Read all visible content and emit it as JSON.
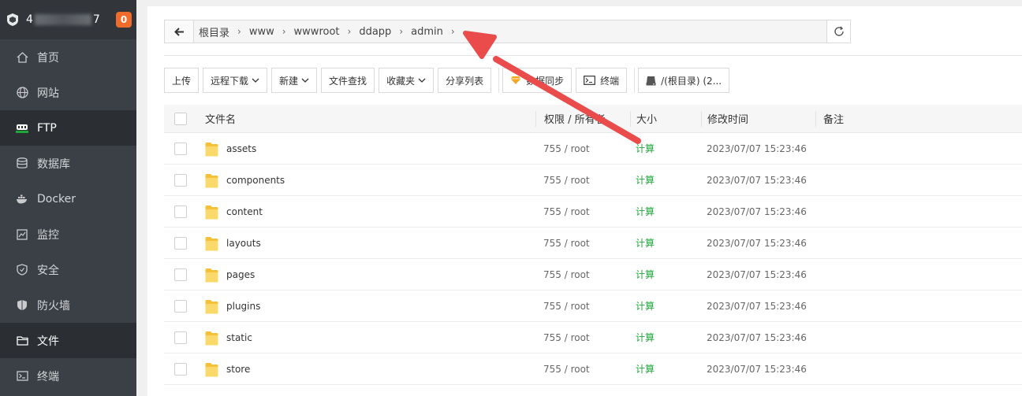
{
  "sidebar": {
    "server_prefix": "4",
    "server_suffix": "7",
    "badge": "0",
    "items": [
      {
        "label": "首页",
        "icon": "home-icon"
      },
      {
        "label": "网站",
        "icon": "globe-icon"
      },
      {
        "label": "FTP",
        "icon": "ftp-icon"
      },
      {
        "label": "数据库",
        "icon": "database-icon"
      },
      {
        "label": "Docker",
        "icon": "docker-icon"
      },
      {
        "label": "监控",
        "icon": "monitor-icon"
      },
      {
        "label": "安全",
        "icon": "shield-icon"
      },
      {
        "label": "防火墙",
        "icon": "firewall-icon"
      },
      {
        "label": "文件",
        "icon": "folder-icon"
      },
      {
        "label": "终端",
        "icon": "terminal-icon"
      }
    ]
  },
  "path": {
    "crumbs": [
      "根目录",
      "www",
      "wwwroot",
      "ddapp",
      "admin"
    ]
  },
  "toolbar": {
    "upload": "上传",
    "remote_download": "远程下载",
    "new": "新建",
    "file_search": "文件查找",
    "favorites": "收藏夹",
    "share_list": "分享列表",
    "sync": "数据同步",
    "terminal": "终端",
    "disk": "/(根目录) (2..."
  },
  "table": {
    "headers": {
      "name": "文件名",
      "perm": "权限 / 所有者",
      "size": "大小",
      "mtime": "修改时间",
      "note": "备注"
    },
    "rows": [
      {
        "name": "assets",
        "perm": "755 / root",
        "size": "计算",
        "mtime": "2023/07/07 15:23:46"
      },
      {
        "name": "components",
        "perm": "755 / root",
        "size": "计算",
        "mtime": "2023/07/07 15:23:46"
      },
      {
        "name": "content",
        "perm": "755 / root",
        "size": "计算",
        "mtime": "2023/07/07 15:23:46"
      },
      {
        "name": "layouts",
        "perm": "755 / root",
        "size": "计算",
        "mtime": "2023/07/07 15:23:46"
      },
      {
        "name": "pages",
        "perm": "755 / root",
        "size": "计算",
        "mtime": "2023/07/07 15:23:46"
      },
      {
        "name": "plugins",
        "perm": "755 / root",
        "size": "计算",
        "mtime": "2023/07/07 15:23:46"
      },
      {
        "name": "static",
        "perm": "755 / root",
        "size": "计算",
        "mtime": "2023/07/07 15:23:46"
      },
      {
        "name": "store",
        "perm": "755 / root",
        "size": "计算",
        "mtime": "2023/07/07 15:23:46"
      }
    ]
  },
  "colors": {
    "sidebar_bg": "#3b4046",
    "accent_green": "#20a53a",
    "badge": "#ef6c2d",
    "annotation_arrow": "#ea4b4b"
  }
}
